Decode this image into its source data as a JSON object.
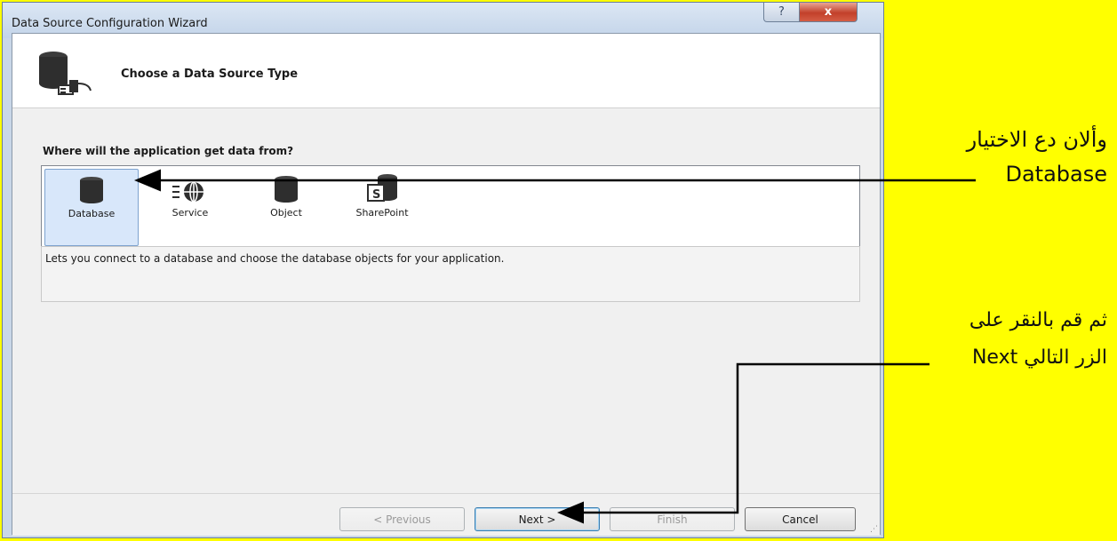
{
  "window": {
    "title": "Data Source Configuration Wizard",
    "help_label": "?",
    "close_label": "x"
  },
  "header": {
    "title": "Choose a Data Source Type"
  },
  "main": {
    "question": "Where will the application get data from?",
    "items": [
      {
        "label": "Database",
        "icon": "database-icon",
        "selected": true
      },
      {
        "label": "Service",
        "icon": "web-service-icon"
      },
      {
        "label": "Object",
        "icon": "object-icon"
      },
      {
        "label": "SharePoint",
        "icon": "sharepoint-icon"
      }
    ],
    "description": "Lets you connect to a database and choose the database objects for your application."
  },
  "buttons": {
    "previous": "< Previous",
    "next": "Next >",
    "finish": "Finish",
    "cancel": "Cancel"
  },
  "annotations": {
    "line1": "وألان دع الاختيار",
    "line2": "Database",
    "line3": "ثم قم بالنقر على",
    "line4": "الزر التالي Next"
  },
  "colors": {
    "background": "#ffff00",
    "selection": "#d8e7fa",
    "close_button": "#c2402a"
  }
}
